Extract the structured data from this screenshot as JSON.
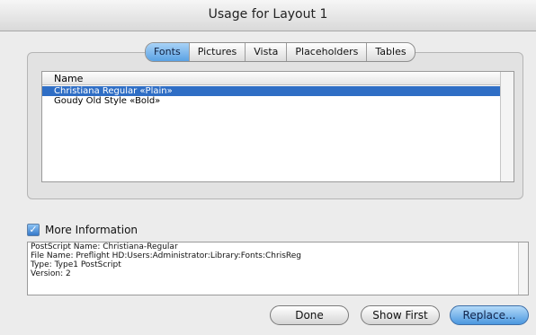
{
  "window": {
    "title": "Usage for Layout 1"
  },
  "tabs": [
    {
      "label": "Fonts",
      "selected": true
    },
    {
      "label": "Pictures",
      "selected": false
    },
    {
      "label": "Vista",
      "selected": false
    },
    {
      "label": "Placeholders",
      "selected": false
    },
    {
      "label": "Tables",
      "selected": false
    }
  ],
  "list": {
    "header": "Name",
    "rows": [
      {
        "name": "Christiana Regular «Plain»",
        "selected": true
      },
      {
        "name": "Goudy Old Style «Bold»",
        "selected": false
      }
    ]
  },
  "more_info": {
    "label": "More Information",
    "checked": true,
    "lines": [
      "PostScript Name:  Christiana-Regular",
      "File Name:  Preflight HD:Users:Administrator:Library:Fonts:ChrisReg",
      "Type: Type1 PostScript",
      "Version:  2"
    ]
  },
  "buttons": {
    "done": "Done",
    "show_first": "Show First",
    "replace": "Replace..."
  },
  "colors": {
    "accent": "#2f6ec5",
    "background": "#ececec"
  }
}
